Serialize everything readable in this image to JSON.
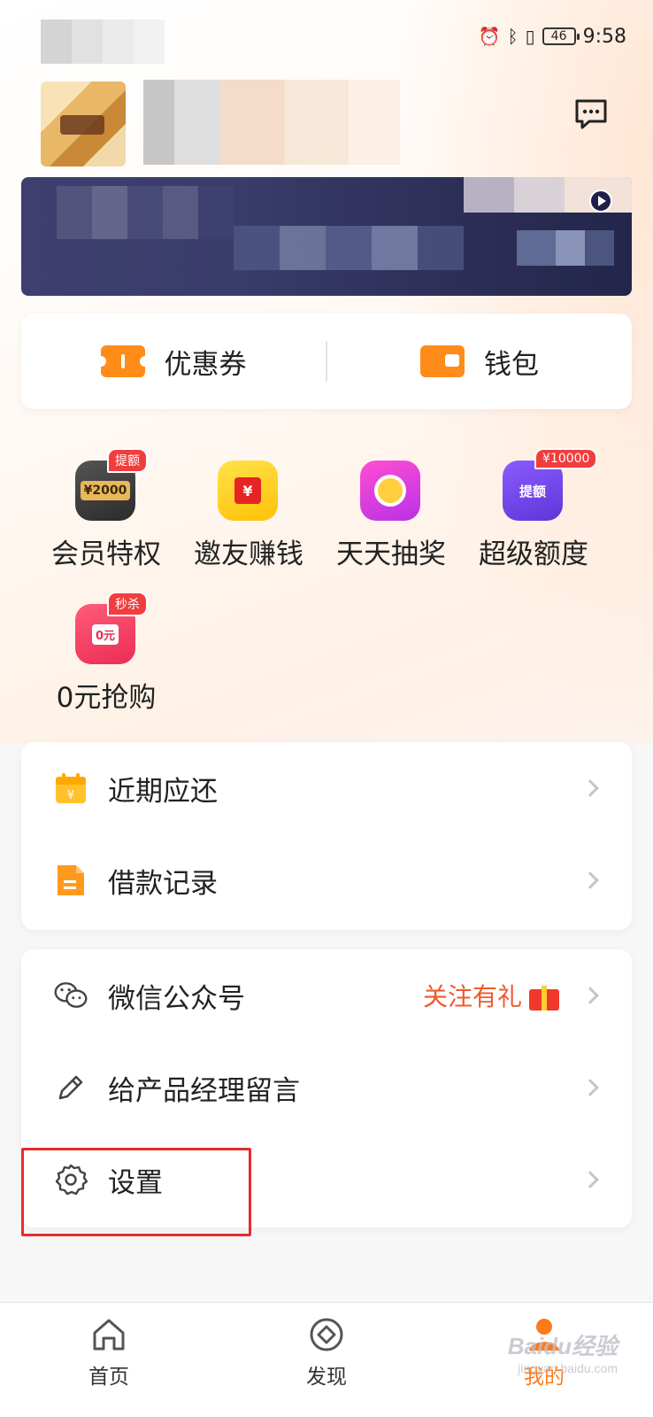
{
  "status_bar": {
    "battery": "46",
    "time": "9:58"
  },
  "quick_actions": [
    {
      "label": "优惠券",
      "icon": "coupon-icon"
    },
    {
      "label": "钱包",
      "icon": "wallet-icon"
    }
  ],
  "features": [
    {
      "label": "会员特权",
      "badge": "提额",
      "icon_text": "¥2000"
    },
    {
      "label": "邀友赚钱",
      "badge": "",
      "icon_text": "¥"
    },
    {
      "label": "天天抽奖",
      "badge": "",
      "icon_text": ""
    },
    {
      "label": "超级额度",
      "badge": "¥10000",
      "icon_text": "提额"
    },
    {
      "label": "0元抢购",
      "badge": "秒杀",
      "icon_text": "0元"
    }
  ],
  "list_group_1": [
    {
      "label": "近期应还",
      "icon": "calendar-icon"
    },
    {
      "label": "借款记录",
      "icon": "document-icon"
    }
  ],
  "list_group_2": [
    {
      "label": "微信公众号",
      "icon": "wechat-icon",
      "extra": "关注有礼"
    },
    {
      "label": "给产品经理留言",
      "icon": "pencil-icon"
    },
    {
      "label": "设置",
      "icon": "gear-icon"
    }
  ],
  "tab_bar": [
    {
      "label": "首页",
      "icon": "home-icon"
    },
    {
      "label": "发现",
      "icon": "discover-icon"
    },
    {
      "label": "我的",
      "icon": "profile-icon"
    }
  ],
  "watermark": {
    "text": "Baidu经验",
    "sub": "jingyan.baidu.com"
  },
  "colors": {
    "accent": "#ff7a18",
    "highlight": "#e62d2d"
  }
}
